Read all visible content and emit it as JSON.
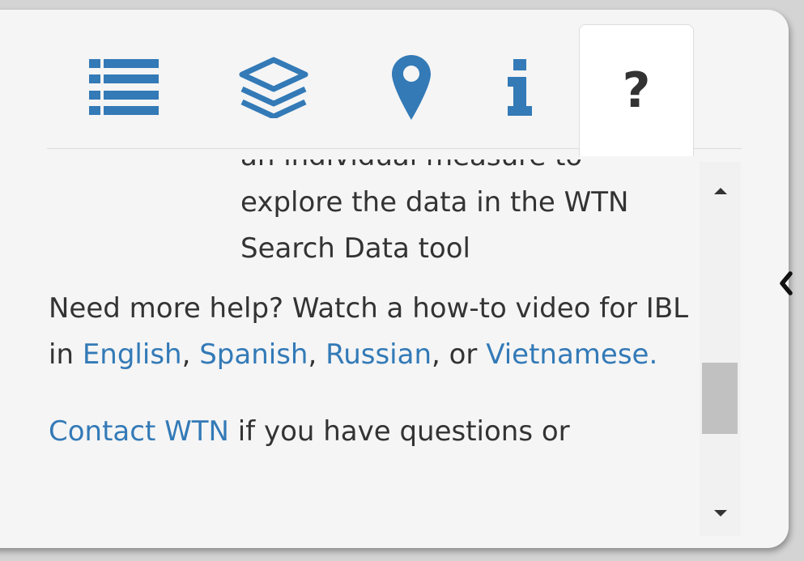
{
  "tabs": {
    "legend": {
      "icon": "list-icon"
    },
    "layers": {
      "icon": "layers-icon"
    },
    "location": {
      "icon": "map-marker-icon"
    },
    "info": {
      "icon": "info-icon"
    },
    "help": {
      "icon": "question-icon",
      "label": "?"
    }
  },
  "help_content": {
    "cut_line": "an individual measure to",
    "line1": "explore the data in the WTN",
    "line2": "Search Data tool",
    "video_prefix": "Need more help? Watch a how-to video for IBL in ",
    "links": {
      "english": "English",
      "spanish": "Spanish",
      "russian": "Russian",
      "vietnamese": "Vietnamese."
    },
    "sep1": ", ",
    "sep2": ", ",
    "sep3": ", or ",
    "contact_link": "Contact WTN",
    "contact_suffix": " if you have questions or"
  },
  "scrollbar": {
    "up_icon": "arrow-up-icon",
    "down_icon": "arrow-down-icon"
  },
  "collapse": {
    "icon": "chevron-left-icon"
  },
  "colors": {
    "accent": "#337ab7",
    "text": "#333333",
    "panel": "#f5f5f5",
    "active_tab": "#ffffff"
  }
}
